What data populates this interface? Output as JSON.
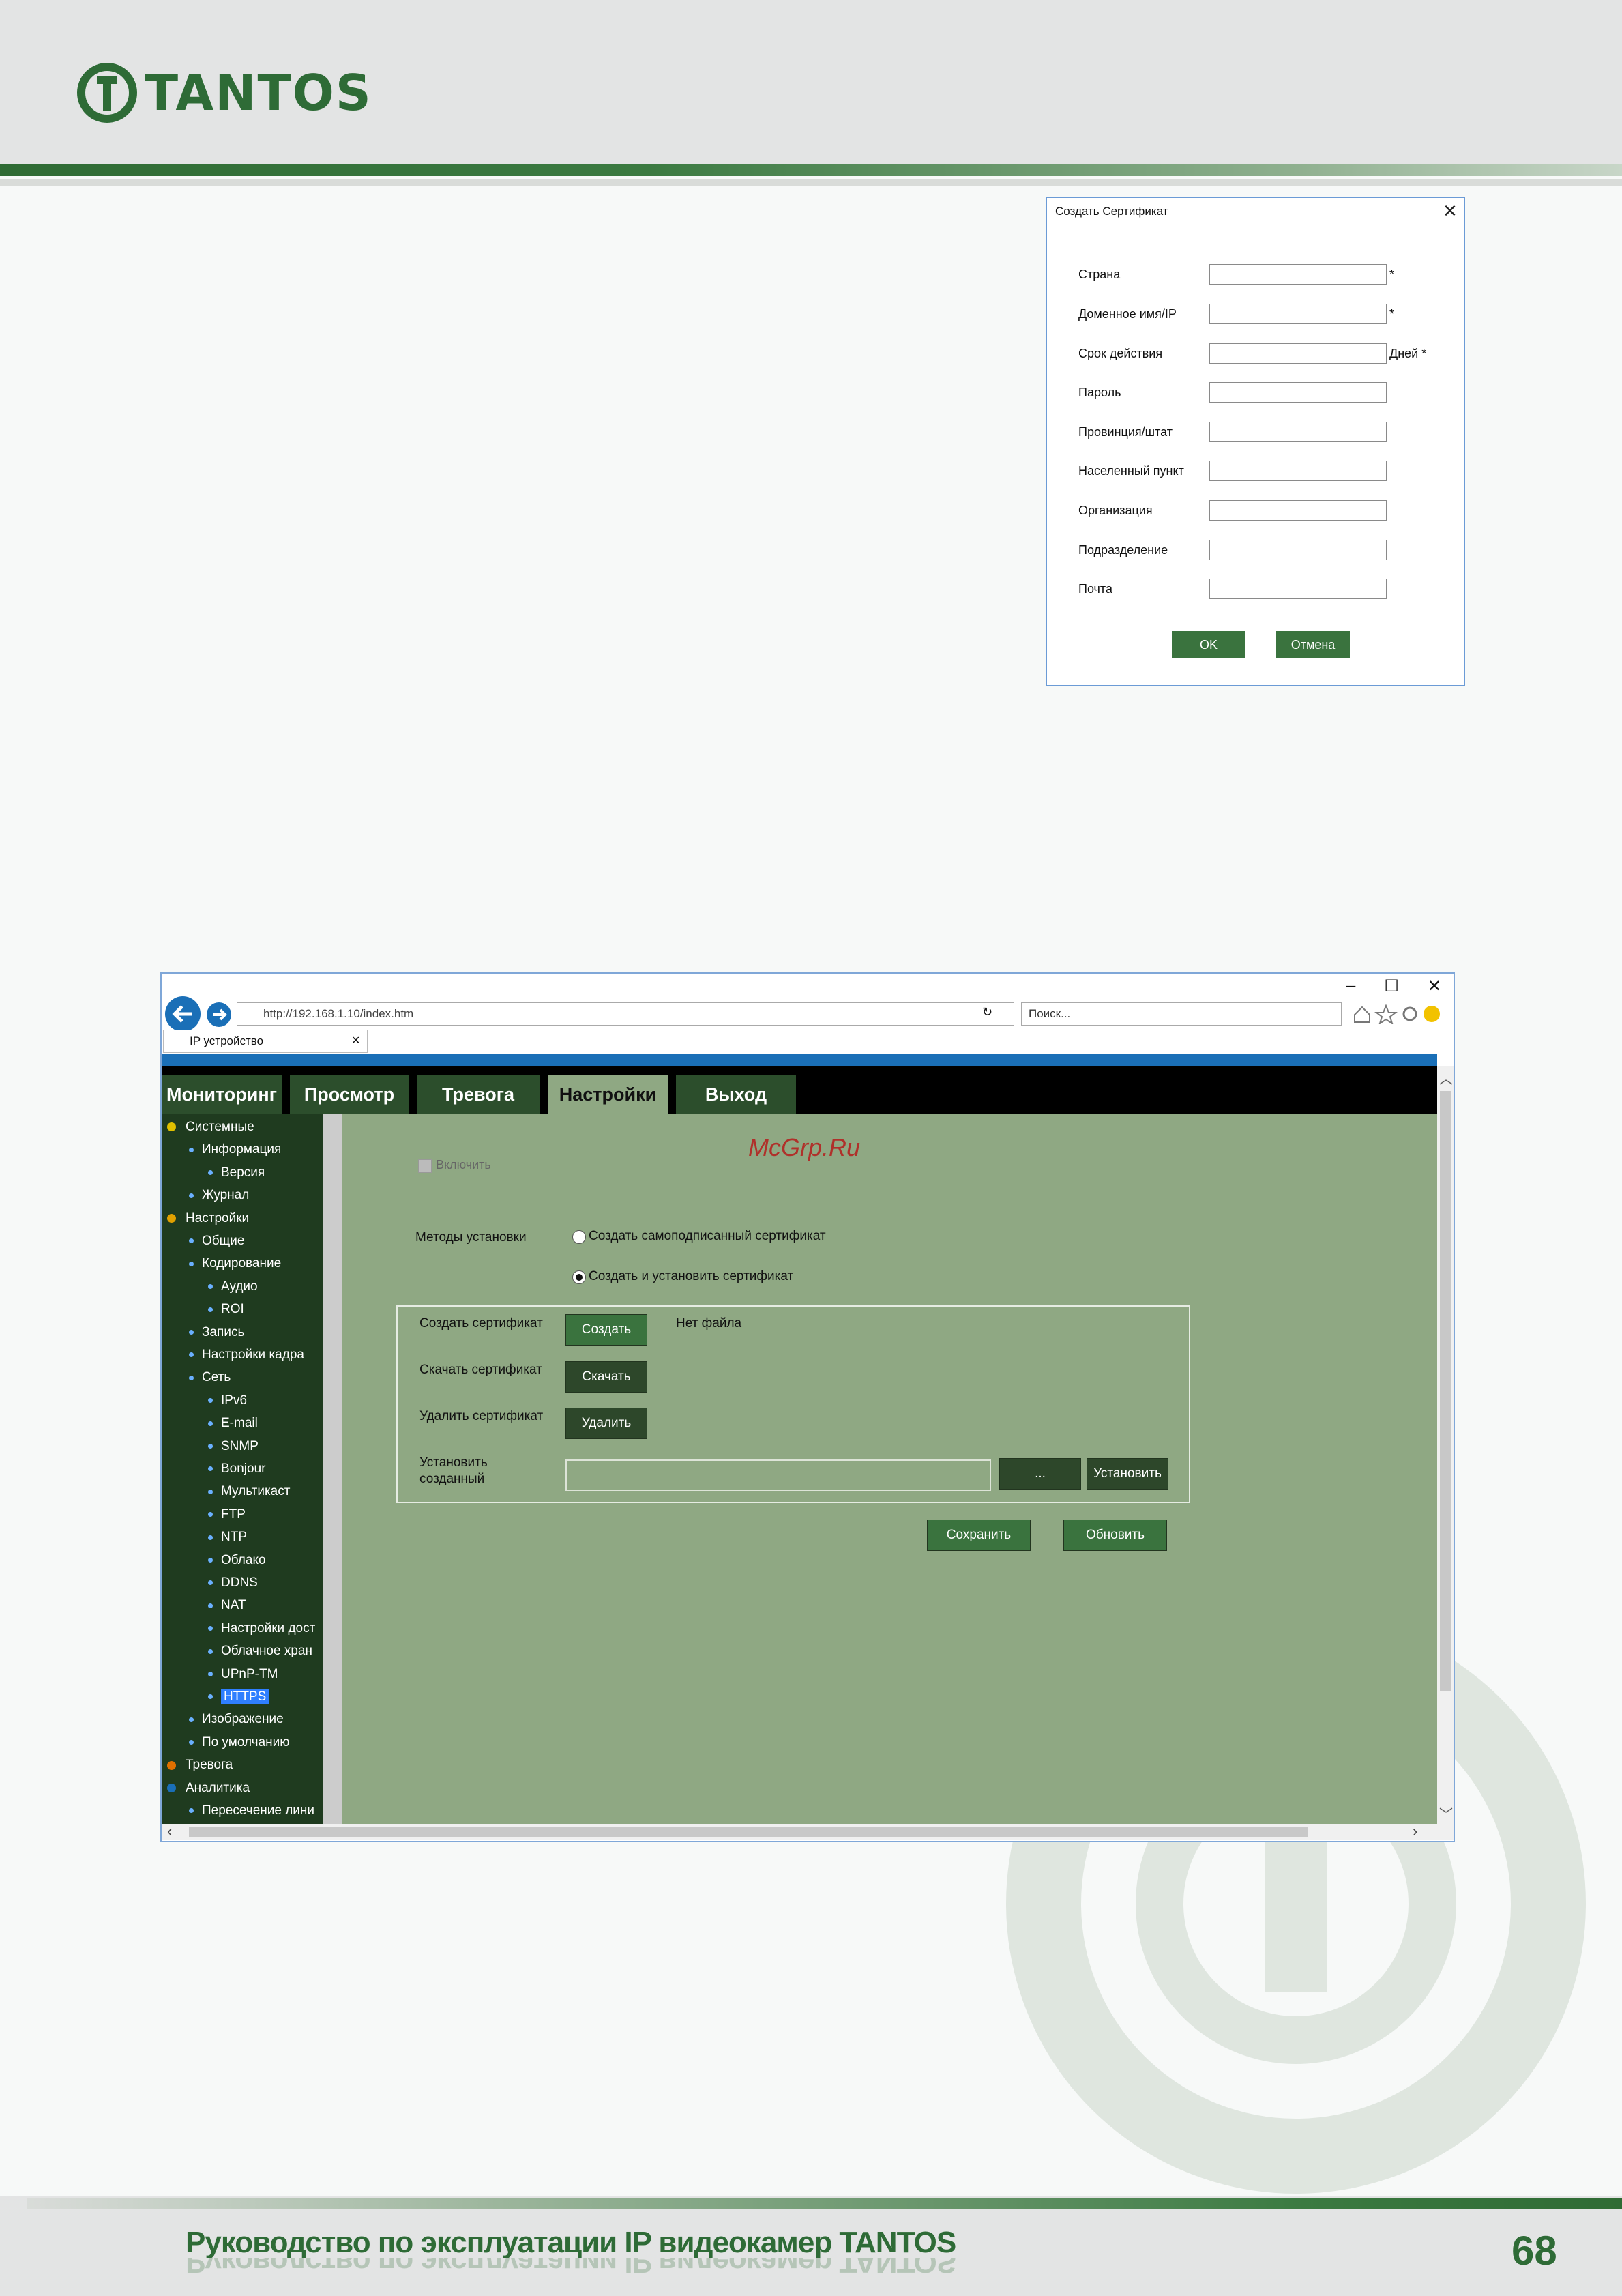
{
  "header": {
    "brand": "TANTOS"
  },
  "footer": {
    "title": "Руководство по эксплуатации IP видеокамер TANTOS",
    "page": "68"
  },
  "dialog": {
    "title": "Создать Сертификат",
    "close": "✕",
    "fields": [
      {
        "label": "Страна",
        "suffix": "*"
      },
      {
        "label": "Доменное имя/IP",
        "suffix": "*"
      },
      {
        "label": "Срок действия",
        "suffix": "Дней  *"
      },
      {
        "label": "Пароль",
        "suffix": ""
      },
      {
        "label": "Провинция/штат",
        "suffix": ""
      },
      {
        "label": "Населенный пункт",
        "suffix": ""
      },
      {
        "label": "Организация",
        "suffix": ""
      },
      {
        "label": "Подразделение",
        "suffix": ""
      },
      {
        "label": "Почта",
        "suffix": ""
      }
    ],
    "ok": "OK",
    "cancel": "Отмена"
  },
  "browser": {
    "url": "http://192.168.1.10/index.htm",
    "search_placeholder": "Поиск...",
    "tab_title": "IP устройство",
    "win_min": "–",
    "win_max": "☐",
    "win_close": "✕"
  },
  "nav": [
    "Мониторинг",
    "Просмотр",
    "Тревога",
    "Настройки",
    "Выход"
  ],
  "sidebar": [
    {
      "label": "Системные",
      "level": 0,
      "icon": "info-icon"
    },
    {
      "label": "Информация",
      "level": 1
    },
    {
      "label": "Версия",
      "level": 2
    },
    {
      "label": "Журнал",
      "level": 1
    },
    {
      "label": "Настройки",
      "level": 0,
      "icon": "settings-icon"
    },
    {
      "label": "Общие",
      "level": 1
    },
    {
      "label": "Кодирование",
      "level": 1
    },
    {
      "label": "Аудио",
      "level": 2
    },
    {
      "label": "ROI",
      "level": 2
    },
    {
      "label": "Запись",
      "level": 1
    },
    {
      "label": "Настройки кадра",
      "level": 1
    },
    {
      "label": "Сеть",
      "level": 1
    },
    {
      "label": "IPv6",
      "level": 2
    },
    {
      "label": "E-mail",
      "level": 2
    },
    {
      "label": "SNMP",
      "level": 2
    },
    {
      "label": "Bonjour",
      "level": 2
    },
    {
      "label": "Мультикаст",
      "level": 2
    },
    {
      "label": "FTP",
      "level": 2
    },
    {
      "label": "NTP",
      "level": 2
    },
    {
      "label": "Облако",
      "level": 2
    },
    {
      "label": "DDNS",
      "level": 2
    },
    {
      "label": "NAT",
      "level": 2
    },
    {
      "label": "Настройки дост",
      "level": 2
    },
    {
      "label": "Облачное хран",
      "level": 2
    },
    {
      "label": "UPnP-TM",
      "level": 2
    },
    {
      "label": "HTTPS",
      "level": 2,
      "selected": true
    },
    {
      "label": "Изображение",
      "level": 1
    },
    {
      "label": "По умолчанию",
      "level": 1
    },
    {
      "label": "Тревога",
      "level": 0,
      "icon": "alarm-icon"
    },
    {
      "label": "Аналитика",
      "level": 0,
      "icon": "analytics-icon"
    },
    {
      "label": "Пересечение лини",
      "level": 1
    }
  ],
  "main": {
    "site_watermark": "McGrp.Ru",
    "enable_label": "Включить",
    "methods_label": "Методы установки",
    "option_self": "Создать самоподписанный сертификат",
    "option_install": "Создать и установить сертификат",
    "create_label": "Создать сертификат",
    "create_btn": "Создать",
    "no_file": "Нет файла",
    "download_label": "Скачать сертификат",
    "download_btn": "Скачать",
    "delete_label": "Удалить сертификат",
    "delete_btn": "Удалить",
    "install_label_1": "Установить",
    "install_label_2": "созданный",
    "browse_btn": "...",
    "install_btn": "Установить",
    "save_btn": "Сохранить",
    "refresh_btn": "Обновить"
  },
  "colors": {
    "brand": "#2e6b36",
    "panel": "#8fa883",
    "sidebar": "#1f3b1f",
    "button": "#3a733e",
    "ie_blue": "#1a6fb7"
  }
}
